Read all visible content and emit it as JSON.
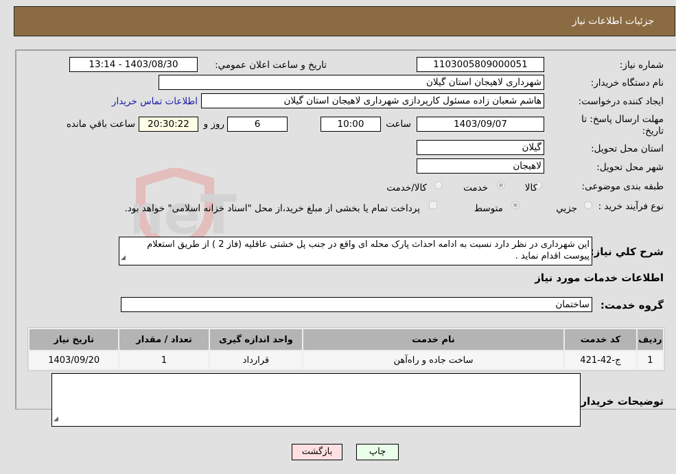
{
  "header": {
    "title": "جزئیات اطلاعات نیاز"
  },
  "form": {
    "need_number": {
      "label": "شماره نیاز:",
      "value": "1103005809000051"
    },
    "announce_datetime": {
      "label": "تاریخ و ساعت اعلان عمومي:",
      "value": "1403/08/30 - 13:14"
    },
    "buyer_org": {
      "label": "نام دستگاه خريدار:",
      "value": "شهرداری لاهیجان استان گیلان"
    },
    "requester": {
      "label": "ایجاد کننده درخواست:",
      "value": "هاشم شعبان زاده مسئول کارپردازی شهرداری لاهیجان استان گیلان",
      "contact_link": "اطلاعات تماس خريدار"
    },
    "deadline": {
      "label": "مهلت ارسال پاسخ: تا تاریخ:",
      "date": "1403/09/07",
      "time_label": "ساعت",
      "time": "10:00",
      "days": "6",
      "days_label": "روز و",
      "remaining": "20:30:22",
      "remaining_label": "ساعت باقي مانده"
    },
    "province": {
      "label": "استان محل تحویل:",
      "value": "گیلان"
    },
    "city": {
      "label": "شهر محل تحویل:",
      "value": "لاهیجان"
    },
    "category": {
      "label": "طبقه بندی موضوعی:",
      "options": [
        "کالا",
        "خدمت",
        "کالا/خدمت"
      ],
      "selected": "خدمت"
    },
    "purchase_type": {
      "label": "نوع فرآیند خرید :",
      "options": [
        "جزيي",
        "متوسط"
      ],
      "selected": "متوسط",
      "treasury_note": "پرداخت تمام یا بخشی از مبلغ خرید،از محل \"اسناد خزانه اسلامی\" خواهد بود.",
      "treasury_checked": false
    },
    "description": {
      "label": "شرح کلي نياز:",
      "value": "این شهرداری در نظر دارد نسبت به ادامه  احداث پارک محله ای  واقع در جنب پل خشتی عاقلیه (فاز 2 ) از طریق استعلام پیوست اقدام نماید ."
    }
  },
  "services": {
    "section_title": "اطلاعات خدمات مورد نياز",
    "group_label": "گروه خدمت:",
    "group_value": "ساختمان",
    "table": {
      "headers": [
        "رديف",
        "کد خدمت",
        "نام خدمت",
        "واحد اندازه گيری",
        "تعداد / مقدار",
        "تاریخ نیاز"
      ],
      "rows": [
        [
          "1",
          "ج-42-421",
          "ساخت جاده و راه‌آهن",
          "قرارداد",
          "1",
          "1403/09/20"
        ]
      ]
    }
  },
  "buyer_notes": {
    "label": "توضیحات خریدار:",
    "value": ""
  },
  "buttons": {
    "print": "چاپ",
    "back": "بازگشت"
  },
  "watermark": {
    "text": "AriaTender.neT"
  },
  "colors": {
    "header_bg": "#8b6c42",
    "print_bg": "#eaffea",
    "back_bg": "#ffe0e0",
    "remaining_bg": "#ffffe6"
  }
}
